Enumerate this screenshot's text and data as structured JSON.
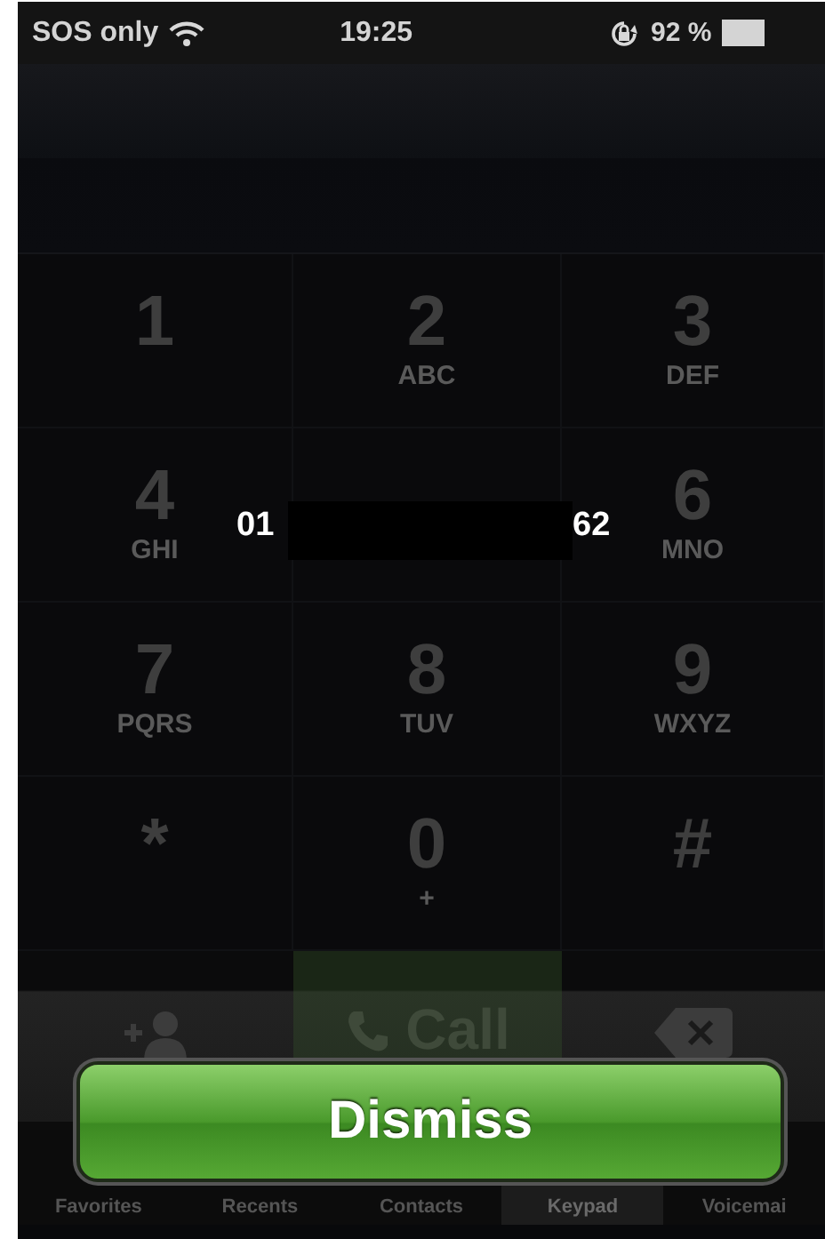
{
  "status_bar": {
    "carrier": "SOS only",
    "time": "19:25",
    "battery": "92 %"
  },
  "keypad": [
    {
      "kind": "key",
      "digit": "1"
    },
    {
      "kind": "key",
      "digit": "2",
      "letters": "ABC"
    },
    {
      "kind": "key",
      "digit": "3",
      "letters": "DEF"
    },
    {
      "kind": "key",
      "digit": "4",
      "letters": "GHI"
    },
    {
      "kind": "covered"
    },
    {
      "kind": "key",
      "digit": "6",
      "letters": "MNO"
    },
    {
      "kind": "key",
      "digit": "7",
      "letters": "PQRS"
    },
    {
      "kind": "key",
      "digit": "8",
      "letters": "TUV"
    },
    {
      "kind": "key",
      "digit": "9",
      "letters": "WXYZ"
    },
    {
      "kind": "key",
      "digit": "*"
    },
    {
      "kind": "key",
      "digit": "0",
      "letters": "+"
    },
    {
      "kind": "key",
      "digit": "#"
    }
  ],
  "call_button": {
    "label": "Call"
  },
  "tabs": [
    {
      "label": "Favorites",
      "selected": false
    },
    {
      "label": "Recents",
      "selected": false
    },
    {
      "label": "Contacts",
      "selected": false
    },
    {
      "label": "Keypad",
      "selected": true
    },
    {
      "label": "Voicemai",
      "selected": false
    }
  ],
  "alert": {
    "number_start": "01",
    "number_end": "62",
    "button": "Dismiss"
  }
}
